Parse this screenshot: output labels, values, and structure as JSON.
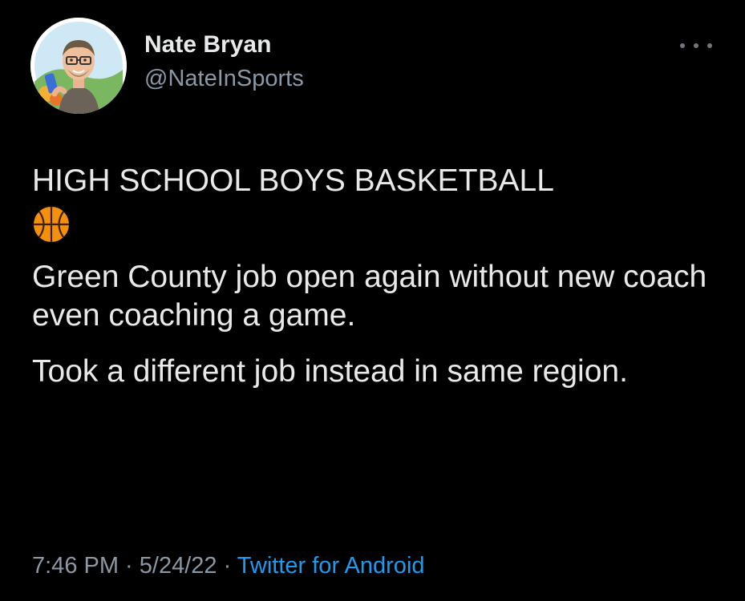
{
  "author": {
    "name": "Nate Bryan",
    "handle": "@NateInSports"
  },
  "icons": {
    "more": "more-options-icon",
    "avatar": "avatar-image",
    "emoji": "basketball-emoji-icon"
  },
  "tweet": {
    "heading": "HIGH SCHOOL BOYS BASKETBALL",
    "paragraph_1": "Green County job open again without new coach even coaching a game.",
    "paragraph_2": "Took a different job instead in same region."
  },
  "meta": {
    "time": "7:46 PM",
    "separator_1": " · ",
    "date": "5/24/22",
    "separator_2": " · ",
    "source": "Twitter for Android"
  },
  "colors": {
    "background": "#000000",
    "text": "#e7e9ea",
    "secondary_text": "#8b98a5",
    "link": "#1d9bf0"
  }
}
